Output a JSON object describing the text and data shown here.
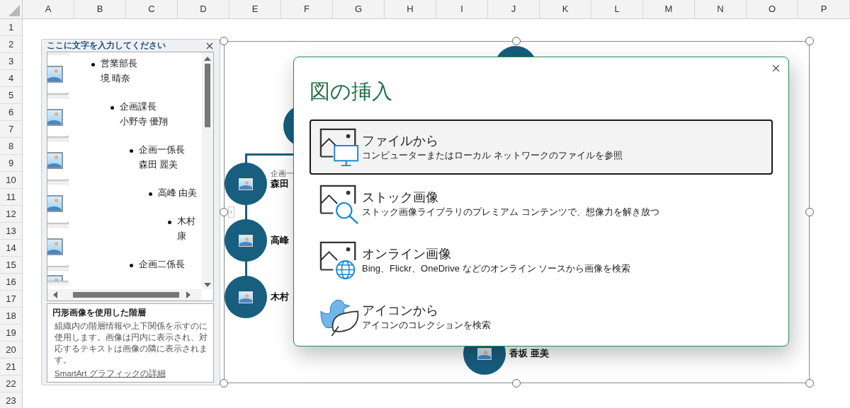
{
  "sheet": {
    "columns": [
      "A",
      "B",
      "C",
      "D",
      "E",
      "F",
      "G",
      "H",
      "I",
      "J",
      "K",
      "L",
      "M",
      "N",
      "O",
      "P"
    ],
    "rows": [
      "1",
      "2",
      "3",
      "4",
      "5",
      "6",
      "7",
      "8",
      "9",
      "10",
      "11",
      "12",
      "13",
      "14",
      "15",
      "16",
      "17",
      "18",
      "19",
      "20",
      "21",
      "22",
      "23"
    ]
  },
  "text_pane": {
    "title": "ここに文字を入力してください",
    "items": [
      {
        "lines": [
          "営業部長",
          "境 晴奈"
        ],
        "children": [
          {
            "lines": [
              "企画課長",
              "小野寺 優翔"
            ],
            "children": [
              {
                "lines": [
                  "企画一係長",
                  "森田 麗美"
                ],
                "children": [
                  {
                    "lines": [
                      "高峰 由美"
                    ],
                    "children": [
                      {
                        "lines": [
                          "木村",
                          "康"
                        ]
                      }
                    ]
                  }
                ]
              },
              {
                "lines": [
                  "企画二係長"
                ]
              }
            ]
          }
        ]
      }
    ],
    "description": {
      "title": "円形画像を使用した階層",
      "text": "組織内の階層情報や上下関係を示すのに使用します。画像は円内に表示され、対応するテキストは画像の隣に表示されます。",
      "link": "SmartArt グラフィックの詳細"
    }
  },
  "smartart": {
    "nodes": [
      {
        "name": "森田"
      },
      {
        "name": "高峰"
      },
      {
        "name": "木村"
      },
      {
        "name": "香坂 亜美"
      }
    ],
    "role_text": "企画一"
  },
  "dialog": {
    "title": "図の挿入",
    "options": [
      {
        "kind": "file",
        "title": "ファイルから",
        "description": "コンピューターまたはローカル ネットワークのファイルを参照",
        "selected": true
      },
      {
        "kind": "stock",
        "title": "ストック画像",
        "description": "ストック画像ライブラリのプレミアム コンテンツで、想像力を解き放つ",
        "selected": false
      },
      {
        "kind": "online",
        "title": "オンライン画像",
        "description": "Bing、Flickr、OneDrive などのオンライン ソースから画像を検索",
        "selected": false
      },
      {
        "kind": "icons",
        "title": "アイコンから",
        "description": "アイコンのコレクションを検索",
        "selected": false
      }
    ]
  }
}
